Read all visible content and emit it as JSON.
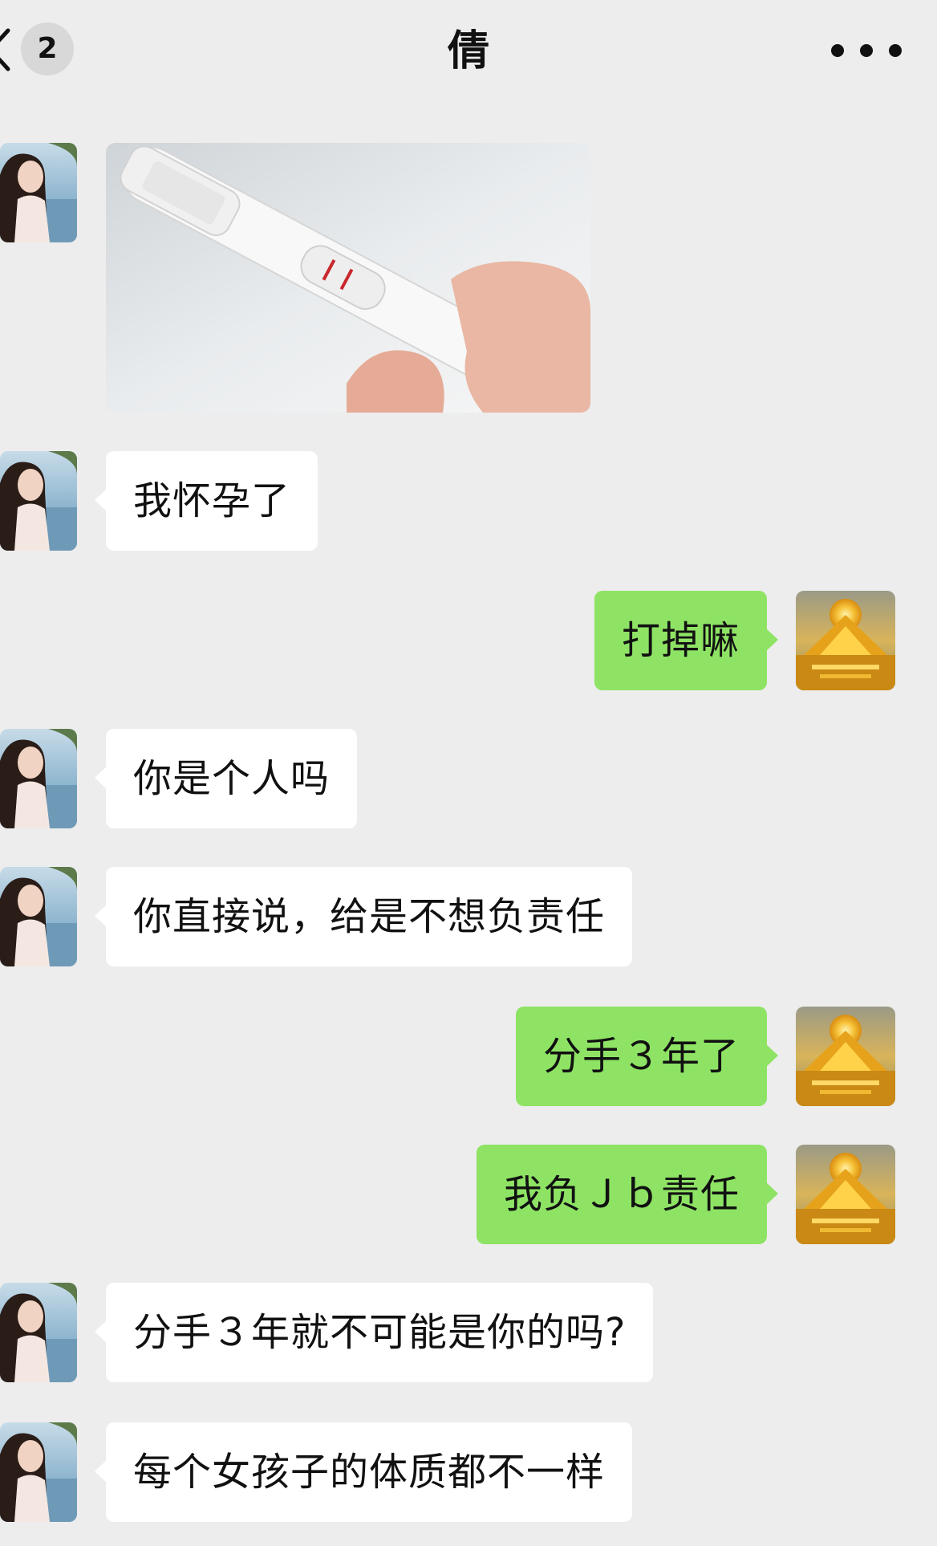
{
  "header": {
    "unread_count": "2",
    "title": "倩",
    "back_icon": "chevron-left-icon",
    "more_icon": "more-horizontal-icon"
  },
  "colors": {
    "background": "#ededed",
    "incoming_bubble": "#ffffff",
    "outgoing_bubble": "#8ee364",
    "badge": "#d8d8d8"
  },
  "messages": [
    {
      "sender": "contact",
      "type": "image",
      "image_subject": "pregnancy-test"
    },
    {
      "sender": "contact",
      "type": "text",
      "text": "我怀孕了"
    },
    {
      "sender": "me",
      "type": "text",
      "text": "打掉嘛"
    },
    {
      "sender": "contact",
      "type": "text",
      "text": "你是个人吗"
    },
    {
      "sender": "contact",
      "type": "text",
      "text": "你直接说，给是不想负责任"
    },
    {
      "sender": "me",
      "type": "text",
      "text": "分手３年了"
    },
    {
      "sender": "me",
      "type": "text",
      "text": "我负Ｊｂ责任"
    },
    {
      "sender": "contact",
      "type": "text",
      "text": "分手３年就不可能是你的吗?"
    },
    {
      "sender": "contact",
      "type": "text",
      "text": "每个女孩子的体质都不一样"
    }
  ]
}
